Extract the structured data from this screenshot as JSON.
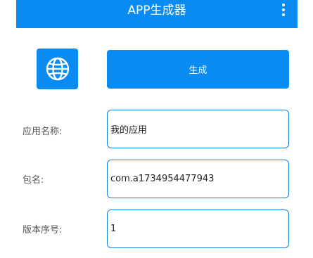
{
  "app_bar": {
    "title": "APP生成器",
    "menu_icon": "more-vertical-icon"
  },
  "icon_tile": {
    "icon": "globe-icon"
  },
  "generate_button": {
    "label": "生成"
  },
  "form": {
    "app_name": {
      "label": "应用名称:",
      "value": "我的应用"
    },
    "package_name": {
      "label": "包名:",
      "value": "com.a1734954477943"
    },
    "version_code": {
      "label": "版本序号:",
      "value": "1"
    }
  },
  "colors": {
    "primary": "#0a8bf2",
    "input_border": "#1a7fd6",
    "label_text": "#555555"
  }
}
